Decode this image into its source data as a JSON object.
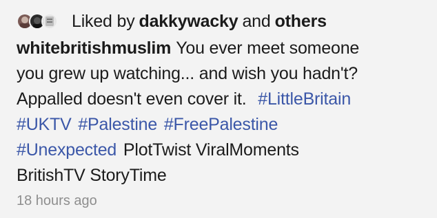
{
  "likes": {
    "prefix": "Liked by",
    "user": "dakkywacky",
    "conjunction": "and",
    "others": "others",
    "avatars": [
      "avatar-1",
      "avatar-2",
      "avatar-3"
    ]
  },
  "caption": {
    "username": "whitebritishmuslim",
    "line1": "You ever meet someone",
    "line2": "you grew up watching... and wish you hadn't?",
    "line3": "Appalled doesn't even cover it.",
    "hashtags": [
      "#LittleBritain",
      "#UKTV",
      "#Palestine",
      "#FreePalestine",
      "#Unexpected"
    ],
    "plain_tags_line5": "PlotTwist ViralMoments",
    "plain_tags_line6": "BritishTV StoryTime"
  },
  "timestamp": "18 hours ago",
  "colors": {
    "hashtag": "#3b57a8",
    "text": "#1b1b1b",
    "timestamp": "#8e8e8e",
    "background": "#f3f3f3"
  }
}
